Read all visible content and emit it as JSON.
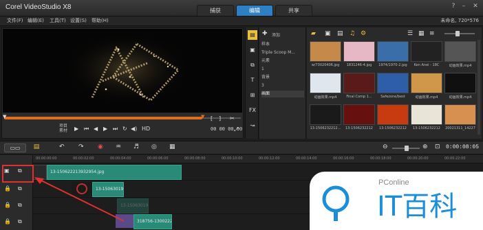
{
  "app": {
    "title": "Corel VideoStudio X8"
  },
  "mode_tabs": [
    {
      "label": "捕获"
    },
    {
      "label": "编辑"
    },
    {
      "label": "共享"
    }
  ],
  "menu": [
    {
      "label": "文件(F)"
    },
    {
      "label": "编辑(E)"
    },
    {
      "label": "工具(T)"
    },
    {
      "label": "设置(S)"
    },
    {
      "label": "帮助(H)"
    }
  ],
  "project": {
    "info": "未命名, 720*576"
  },
  "player": {
    "mode_labels": [
      "项目",
      "素材"
    ],
    "transport": {
      "hd": "HD"
    },
    "timecode_label": "00 00 00 00"
  },
  "library": {
    "add_label": "添加",
    "folders": [
      {
        "label": "样本"
      },
      {
        "label": "Triple Scoop M..."
      },
      {
        "label": "元素"
      },
      {
        "label": "1"
      },
      {
        "label": "背景"
      },
      {
        "label": "3"
      },
      {
        "label": "画面"
      }
    ],
    "active_folder": "画面",
    "thumbs": [
      {
        "label": "w/73020406.jpg",
        "color": "#c58a4a"
      },
      {
        "label": "1831246-4.jpg",
        "color": "#e6b8c6"
      },
      {
        "label": "1974/1970-2.jpg",
        "color": "#3a6ea8"
      },
      {
        "label": "Ken Anei - 18C",
        "color": "#222222"
      },
      {
        "label": "动画效果.mp4",
        "color": "#555555"
      },
      {
        "label": "动画效果.mp4",
        "color": "#dfe6ee"
      },
      {
        "label": "Final Comp 1...",
        "color": "#5a1a1a"
      },
      {
        "label": "Safezone/best",
        "color": "#2f5ea8"
      },
      {
        "label": "动画效果.mp4",
        "color": "#d0964a"
      },
      {
        "label": "动画效果.mp4",
        "color": "#101010"
      },
      {
        "label": "13-1506232212...",
        "color": "#1a1a1a"
      },
      {
        "label": "13-1506232212",
        "color": "#661010"
      },
      {
        "label": "13-1506232212",
        "color": "#c83a10"
      },
      {
        "label": "13-1506232212",
        "color": "#e8e4d8"
      },
      {
        "label": "20021311_14227",
        "color": "#d89050"
      }
    ]
  },
  "timeline": {
    "timecode": "0:00:08:05",
    "ruler": [
      "00:00:00:00",
      "00:00:02:00",
      "00:00:04:00",
      "00:00:06:00",
      "00:00:08:00",
      "00:00:10:00",
      "00:00:12:00",
      "00:00:14:00",
      "00:00:16:00",
      "00:00:18:00",
      "00:00:20:00",
      "00:00:22:00"
    ],
    "clips": [
      {
        "label": "13-150622213932954.jpg"
      },
      {
        "label": "13-15063019"
      },
      {
        "label": "13-15063019"
      },
      {
        "label": "318756-1300222"
      }
    ]
  },
  "watermark": {
    "brand": "PConline",
    "name": "IT百科"
  }
}
